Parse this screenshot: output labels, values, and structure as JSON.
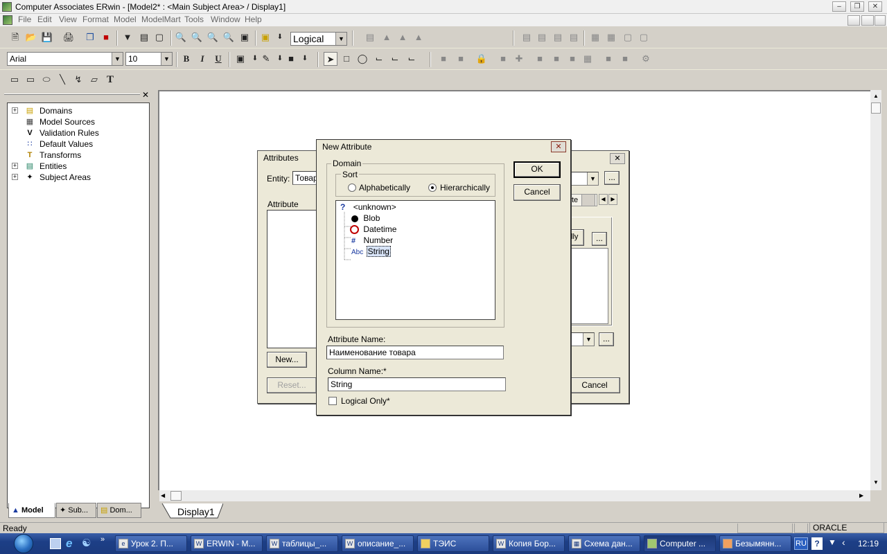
{
  "window": {
    "title": "Computer Associates ERwin - [Model2* : <Main Subject Area> / Display1]"
  },
  "menu": [
    "File",
    "Edit",
    "View",
    "Format",
    "Model",
    "ModelMart",
    "Tools",
    "Window",
    "Help"
  ],
  "toolbar": {
    "view_mode": "Logical",
    "font_name": "Arial",
    "font_size": "10",
    "bold": "B",
    "italic": "I",
    "underline": "U",
    "text_tool": "T"
  },
  "model_panel": {
    "tree": [
      {
        "label": "Domains",
        "expandable": true,
        "icon": "domains-icon"
      },
      {
        "label": "Model Sources",
        "expandable": false,
        "icon": "model-sources-icon"
      },
      {
        "label": "Validation Rules",
        "expandable": false,
        "icon": "validation-rules-icon"
      },
      {
        "label": "Default Values",
        "expandable": false,
        "icon": "default-values-icon"
      },
      {
        "label": "Transforms",
        "expandable": false,
        "icon": "transforms-icon"
      },
      {
        "label": "Entities",
        "expandable": true,
        "icon": "entities-icon"
      },
      {
        "label": "Subject Areas",
        "expandable": true,
        "icon": "subject-areas-icon"
      }
    ],
    "tabs": [
      "Model",
      "Sub...",
      "Dom..."
    ]
  },
  "canvas_tab": "Display1",
  "attributes_dialog": {
    "title": "Attributes",
    "entity_label": "Entity:",
    "entity_value": "Товар",
    "attribute_label": "Attribute",
    "new_button": "New...",
    "reset_button": "Reset...",
    "cancel_button": "Cancel",
    "tab_fragment": "te",
    "button_fragment": "lly"
  },
  "new_attribute_dialog": {
    "title": "New Attribute",
    "domain_group": "Domain",
    "sort_group": "Sort",
    "sort_options": [
      "Alphabetically",
      "Hierarchically"
    ],
    "sort_selected": "Hierarchically",
    "domains": [
      "<unknown>",
      "Blob",
      "Datetime",
      "Number",
      "String"
    ],
    "selected_domain": "String",
    "attribute_name_label": "Attribute Name:",
    "attribute_name_value": "Наименование товара",
    "column_name_label": "Column Name:*",
    "column_name_value": "String",
    "logical_only_label": "Logical Only*",
    "logical_only_checked": false,
    "ok_button": "OK",
    "cancel_button": "Cancel"
  },
  "status": {
    "left": "Ready",
    "right": "ORACLE"
  },
  "taskbar": {
    "tasks": [
      "Урок 2. П...",
      "ERWIN - M...",
      "таблицы_...",
      "описание_...",
      "ТЭИС",
      "Копия Бор...",
      "Схема дан...",
      "Computer ...",
      "Безымянн..."
    ],
    "language": "RU",
    "clock": "12:19"
  },
  "colors": {
    "taskbar": "#1d3f86",
    "dialog_bg": "#ece9d8",
    "canvas": "#ffffff"
  }
}
